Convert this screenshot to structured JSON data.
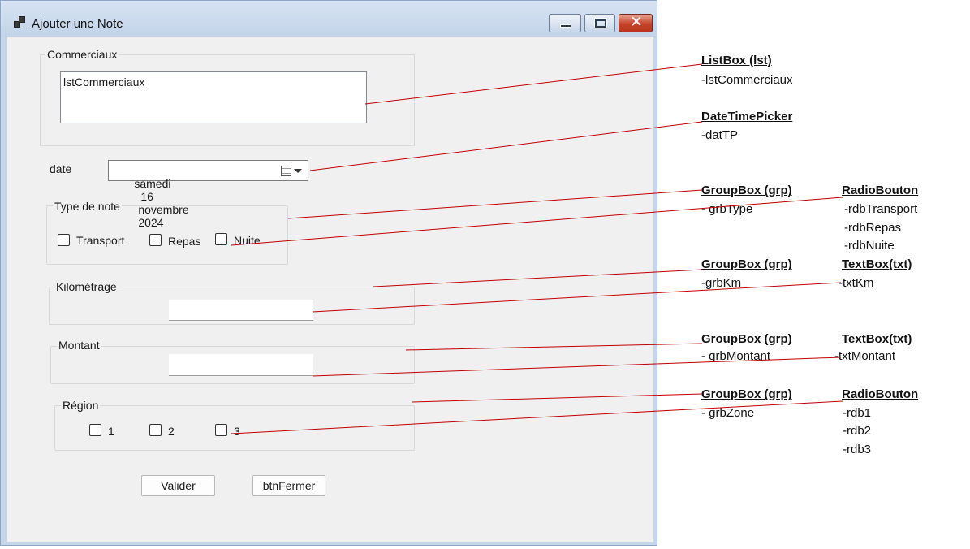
{
  "window": {
    "title": "Ajouter une Note",
    "icons": {
      "app": "form-icon",
      "minimize": "minimize-icon",
      "maximize": "maximize-icon",
      "close": "close-icon"
    },
    "close_glyph": "✕"
  },
  "form": {
    "commerciaux": {
      "legend": "Commerciaux",
      "list_text": "lstCommerciaux"
    },
    "date": {
      "label": "date",
      "day_name": "samedi",
      "day": "16",
      "month": "novembre",
      "year": "2024"
    },
    "type_note": {
      "legend": "Type de note",
      "options": [
        {
          "label": "Transport"
        },
        {
          "label": "Repas"
        },
        {
          "label": "Nuite"
        }
      ]
    },
    "kilometrage": {
      "legend": "Kilométrage",
      "value": ""
    },
    "montant": {
      "legend": "Montant",
      "value": ""
    },
    "region": {
      "legend": "Région",
      "options": [
        {
          "label": "1"
        },
        {
          "label": "2"
        },
        {
          "label": "3"
        }
      ]
    },
    "buttons": {
      "validate": "Valider",
      "close": "btnFermer"
    }
  },
  "annotations": [
    {
      "head": "ListBox (lst)",
      "items": [
        "-lstCommerciaux"
      ]
    },
    {
      "head": "DateTimePicker",
      "items": [
        "-datTP"
      ]
    },
    {
      "head": "GroupBox  (grp)",
      "items": [
        "- grbType"
      ]
    },
    {
      "head": "RadioBouton",
      "items": [
        "-rdbTransport",
        "-rdbRepas",
        "-rdbNuite"
      ]
    },
    {
      "head": "GroupBox  (grp)",
      "items": [
        "-grbKm"
      ]
    },
    {
      "head": "TextBox(txt)",
      "items": [
        "-txtKm"
      ]
    },
    {
      "head": "GroupBox  (grp)",
      "items": [
        "- grbMontant"
      ]
    },
    {
      "head": "TextBox(txt)",
      "items": [
        "-txtMontant"
      ]
    },
    {
      "head": "GroupBox  (grp)",
      "items": [
        "- grbZone"
      ]
    },
    {
      "head": "RadioBouton",
      "items": [
        "-rdb1",
        "-rdb2",
        "-rdb3"
      ]
    }
  ],
  "colors": {
    "connector": "#c00000",
    "window_frame": "#c5d6ea",
    "client_bg": "#f0f0f0"
  }
}
